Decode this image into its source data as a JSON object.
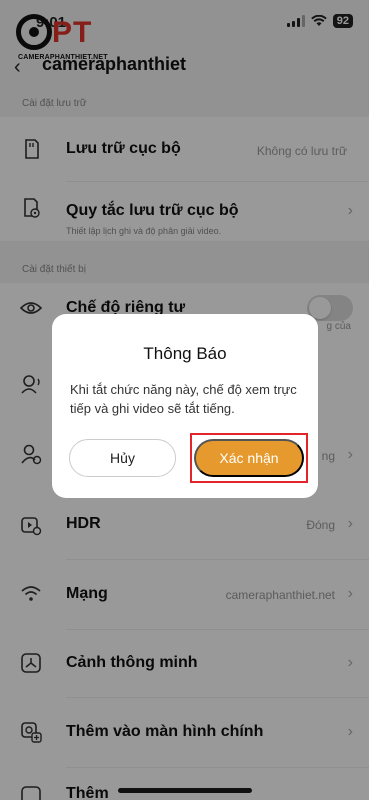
{
  "status": {
    "time": "9:01",
    "battery": "92"
  },
  "logo": {
    "letters": "PT",
    "subtitle": "CAMERAPHANTHIET.NET"
  },
  "header": {
    "title": "cameraphanthiet"
  },
  "sections": {
    "storage": "Cài đặt lưu trữ",
    "device": "Cài đặt thiết bị"
  },
  "rows": {
    "local_storage": {
      "title": "Lưu trữ cục bộ",
      "value": "Không có lưu trữ"
    },
    "storage_rules": {
      "title": "Quy tắc lưu trữ cục bộ",
      "sub": "Thiết lập lịch ghi và độ phân giải video."
    },
    "privacy": {
      "title": "Chế độ riêng tư",
      "sub_right": "g của"
    },
    "user_value": "ng",
    "hdr": {
      "title": "HDR",
      "value": "Đóng"
    },
    "network": {
      "title": "Mạng",
      "value": "cameraphanthiet.net"
    },
    "smart_scene": {
      "title": "Cảnh thông minh"
    },
    "add_home": {
      "title": "Thêm vào màn hình chính"
    },
    "more": {
      "title": "Thêm"
    }
  },
  "dialog": {
    "title": "Thông Báo",
    "body": "Khi tắt chức năng này, chế độ xem trực tiếp và ghi video sẽ tắt tiếng.",
    "cancel": "Hủy",
    "confirm": "Xác nhận"
  },
  "colors": {
    "accent": "#e69a2e",
    "highlight": "#e3242b",
    "logo_red": "#e0332b"
  }
}
